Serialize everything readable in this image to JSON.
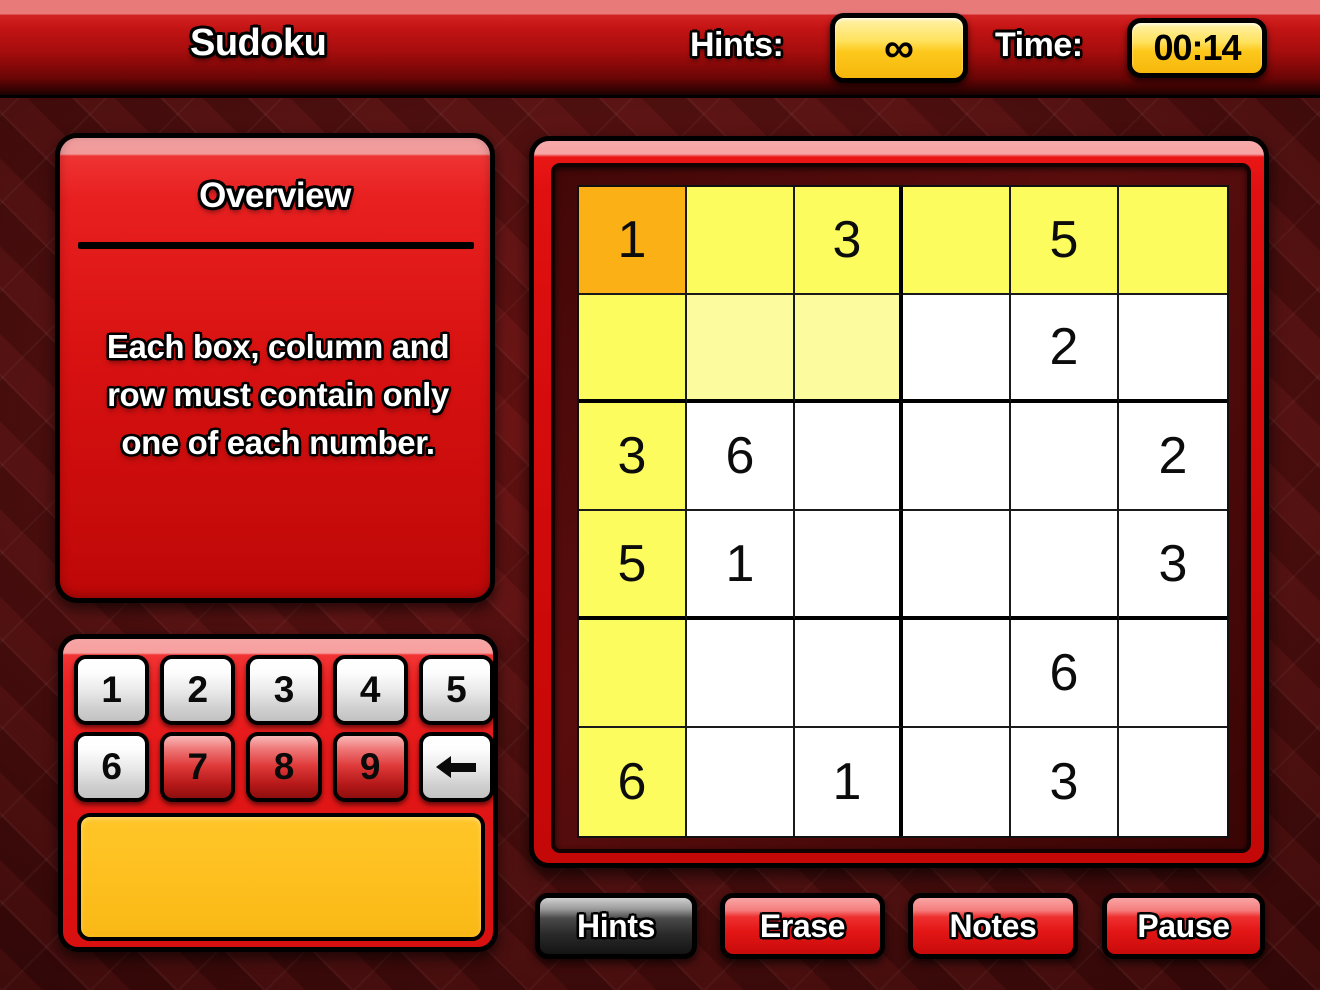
{
  "topbar": {
    "title": "Sudoku",
    "hints_label": "Hints:",
    "hints_value": "∞",
    "time_label": "Time:",
    "time_value": "00:14"
  },
  "overview": {
    "title": "Overview",
    "body": "Each box, column and row must contain only one of each number."
  },
  "numpad": {
    "keys": [
      {
        "label": "1",
        "state": "enabled"
      },
      {
        "label": "2",
        "state": "enabled"
      },
      {
        "label": "3",
        "state": "enabled"
      },
      {
        "label": "4",
        "state": "enabled"
      },
      {
        "label": "5",
        "state": "enabled"
      },
      {
        "label": "6",
        "state": "enabled"
      },
      {
        "label": "7",
        "state": "disabled"
      },
      {
        "label": "8",
        "state": "disabled"
      },
      {
        "label": "9",
        "state": "disabled"
      }
    ],
    "erase_key_icon": "back-arrow-icon",
    "notes_display_value": ""
  },
  "actions": [
    {
      "label": "Hints",
      "state": "dim"
    },
    {
      "label": "Erase",
      "state": "live"
    },
    {
      "label": "Notes",
      "state": "live"
    },
    {
      "label": "Pause",
      "state": "live"
    }
  ],
  "board": {
    "size": 6,
    "box_cols": 3,
    "box_rows": 2,
    "selected": {
      "row": 0,
      "col": 0
    },
    "rows": [
      [
        "1",
        "",
        "3",
        "",
        "5",
        ""
      ],
      [
        "",
        "",
        "",
        "",
        "2",
        ""
      ],
      [
        "3",
        "6",
        "",
        "",
        "",
        "2"
      ],
      [
        "5",
        "1",
        "",
        "",
        "",
        "3"
      ],
      [
        "",
        "",
        "",
        "",
        "6",
        ""
      ],
      [
        "6",
        "",
        "1",
        "",
        "3",
        ""
      ]
    ]
  },
  "colors": {
    "selected_cell": "#fbb015",
    "highlight_line": "#fcfc5e",
    "highlight_box": "#fcfc9e",
    "panel_red": "#e21616",
    "badge_yellow": "#fdc81c",
    "background_dark_red": "#4a0d0d"
  }
}
